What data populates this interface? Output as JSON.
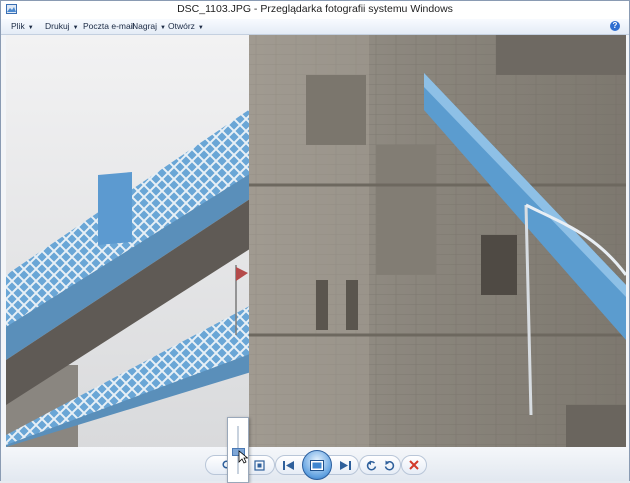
{
  "window": {
    "title": "DSC_1103.JPG - Przeglądarka fotografii systemu Windows"
  },
  "menu": {
    "items": [
      {
        "label": "Plik"
      },
      {
        "label": "Drukuj"
      },
      {
        "label": "Poczta e-mail"
      },
      {
        "label": "Nagraj"
      },
      {
        "label": "Otwórz"
      }
    ],
    "help_icon": "help-icon"
  },
  "photo": {
    "subject": "Tower Bridge",
    "icon": "photo"
  },
  "toolbar": {
    "buttons": [
      {
        "name": "zoom",
        "icon": "magnifier-icon"
      },
      {
        "name": "actual-size",
        "icon": "fit-window-icon"
      },
      {
        "name": "previous",
        "icon": "previous-icon"
      },
      {
        "name": "slideshow",
        "icon": "slideshow-icon"
      },
      {
        "name": "next",
        "icon": "next-icon"
      },
      {
        "name": "rotate-counterclockwise",
        "icon": "rotate-left-icon"
      },
      {
        "name": "rotate-clockwise",
        "icon": "rotate-right-icon"
      },
      {
        "name": "delete",
        "icon": "delete-icon"
      }
    ],
    "zoom_level": 0.45
  },
  "colors": {
    "accent": "#2c68b0",
    "delete": "#d23a2a",
    "bridge_blue": "#5b9ccf"
  }
}
